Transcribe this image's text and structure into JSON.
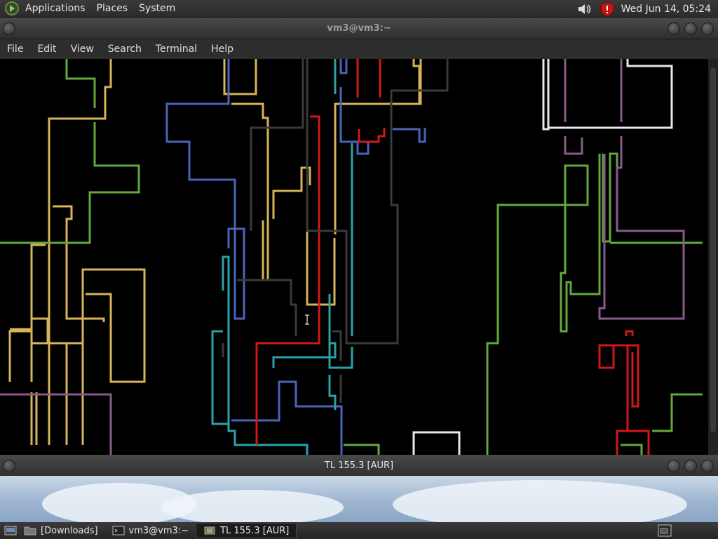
{
  "top_panel": {
    "menus": [
      "Applications",
      "Places",
      "System"
    ],
    "clock": "Wed Jun 14, 05:24",
    "icons": [
      "distro-logo-icon",
      "speaker-icon",
      "shield-update-icon"
    ]
  },
  "terminal_window": {
    "title": "vm3@vm3:~",
    "menus": [
      "File",
      "Edit",
      "View",
      "Search",
      "Terminal",
      "Help"
    ]
  },
  "second_window": {
    "title": "TL 155.3 [AUR]"
  },
  "bottom_panel": {
    "tasks": [
      {
        "label": "[Downloads]",
        "icon": "folder-icon"
      },
      {
        "label": "vm3@vm3:~",
        "icon": "terminal-icon"
      },
      {
        "label": "TL 155.3 [AUR]",
        "icon": "app-icon"
      }
    ]
  },
  "colors": {
    "yellow": "#d7b35a",
    "green": "#63a83c",
    "blue": "#4a64b8",
    "cyan": "#2aa2a8",
    "red": "#d01818",
    "purple": "#8a5a8c",
    "white": "#e8e8e8",
    "gray": "#3a3a3a"
  }
}
